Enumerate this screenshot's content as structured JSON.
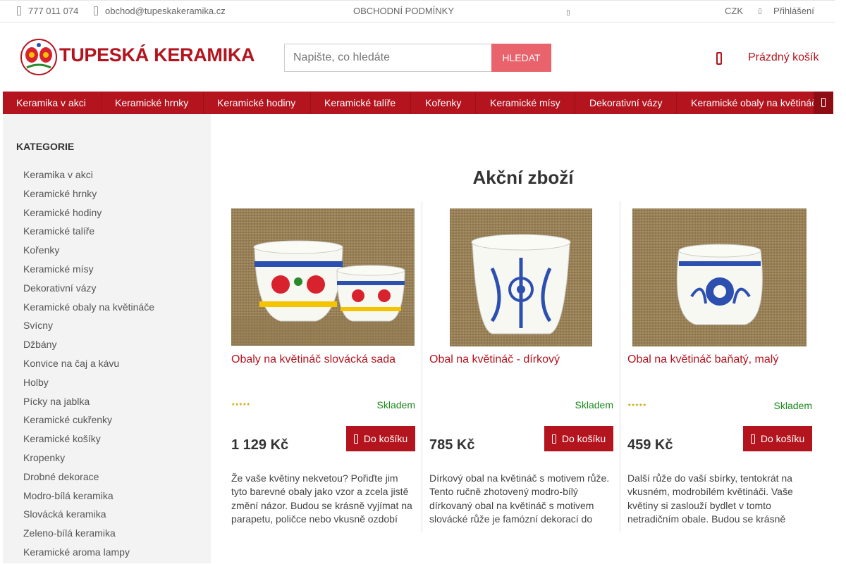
{
  "topbar": {
    "phone": "777 011 074",
    "email": "obchod@tupeskakeramika.cz",
    "terms": "OBCHODNÍ PODMÍNKY",
    "currency": "CZK",
    "login": "Přihlášení"
  },
  "header": {
    "logo_text": "TUPESKÁ KERAMIKA",
    "search_placeholder": "Napište, co hledáte",
    "search_button": "Hledat",
    "cart_label": "Prázdný košík"
  },
  "nav": {
    "items": [
      "Keramika v akci",
      "Keramické hrnky",
      "Keramické hodiny",
      "Keramické talíře",
      "Kořenky",
      "Keramické mísy",
      "Dekorativní vázy",
      "Keramické obaly na květináče"
    ]
  },
  "sidebar": {
    "heading": "KATEGORIE",
    "items": [
      "Keramika v akci",
      "Keramické hrnky",
      "Keramické hodiny",
      "Keramické talíře",
      "Kořenky",
      "Keramické mísy",
      "Dekorativní vázy",
      "Keramické obaly na květináče",
      "Svícny",
      "Džbány",
      "Konvice na čaj a kávu",
      "Holby",
      "Pícky na jablka",
      "Keramické cukřenky",
      "Keramické košíky",
      "Kropenky",
      "Drobné dekorace",
      "Modro-bílá keramika",
      "Slovácká keramika",
      "Zeleno-bílá keramika",
      "Keramické aroma lampy"
    ]
  },
  "main": {
    "title": "Akční zboží",
    "products": [
      {
        "name": "Obaly na květináč slovácká sada",
        "stock": "Skladem",
        "price": "1 129 Kč",
        "button": "Do košíku",
        "rating": 0,
        "description": "Že vaše květiny nekvetou? Pořiďte jim tyto barevné obaly jako vzor a zcela jistě změní názor. Budou se krásně vyjímat na parapetu, poličce nebo vkusně ozdobí"
      },
      {
        "name": "Obal na květináč - dírkový",
        "stock": "Skladem",
        "price": "785 Kč",
        "button": "Do košíku",
        "description": "Dírkový obal na květináč s motivem růže. Tento ručně zhotovený modro-bílý dírkovaný obal na květináč s motivem slovácké růže je famózní dekorací do"
      },
      {
        "name": "Obal na květináč baňatý, malý",
        "stock": "Skladem",
        "price": "459 Kč",
        "button": "Do košíku",
        "rating": 0,
        "description": "Další růže do vaší sbírky, tentokrát na vkusném, modrobílém květináči. Vaše květiny si zaslouží bydlet v tomto netradičním obale. Budou se krásně"
      }
    ]
  },
  "colors": {
    "brand": "#b3141e",
    "search_button": "#e8636b",
    "stock": "#1a8a1a"
  }
}
